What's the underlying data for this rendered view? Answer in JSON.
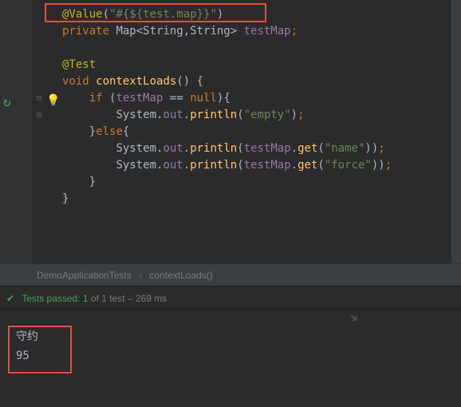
{
  "code": {
    "line1_annotation": "@Value",
    "line1_paren_open": "(",
    "line1_string": "\"#{${test.map}}\"",
    "line1_paren_close": ")",
    "line2_keyword": "private ",
    "line2_type": "Map<String,String> ",
    "line2_id": "testMap",
    "line2_semi": ";",
    "line4": "@Test",
    "line5_kw": "void ",
    "line5_method": "contextLoads",
    "line5_rest": "() {",
    "line6_kw": "if ",
    "line6_open": "(",
    "line6_id": "testMap",
    "line6_op": " == ",
    "line6_null": "null",
    "line6_close": "){",
    "line7_sys": "System.",
    "line7_out": "out",
    "line7_dot": ".",
    "line7_println": "println",
    "line7_open": "(",
    "line7_str": "\"empty\"",
    "line7_close": ")",
    "line7_semi": ";",
    "line8_else": "}",
    "line8_kw": "else",
    "line8_brace": "{",
    "line9_sys": "System.",
    "line9_out": "out",
    "line9_dot": ".",
    "line9_println": "println",
    "line9_open": "(",
    "line9_id": "testMap",
    "line9_dot2": ".",
    "line9_get": "get",
    "line9_open2": "(",
    "line9_str": "\"name\"",
    "line9_close": "))",
    "line9_semi": ";",
    "line10_sys": "System.",
    "line10_out": "out",
    "line10_dot": ".",
    "line10_println": "println",
    "line10_open": "(",
    "line10_id": "testMap",
    "line10_dot2": ".",
    "line10_get": "get",
    "line10_open2": "(",
    "line10_str": "\"force\"",
    "line10_close": "))",
    "line10_semi": ";",
    "line11": "}",
    "line12": "}"
  },
  "breadcrumb": {
    "item1": "DemoApplicationTests",
    "item2": "contextLoads()"
  },
  "test": {
    "label_passed": "Tests passed:",
    "count": " 1 ",
    "of_text": "of 1 test – 269 ms"
  },
  "console": {
    "line1": "守约",
    "line2": "95"
  }
}
